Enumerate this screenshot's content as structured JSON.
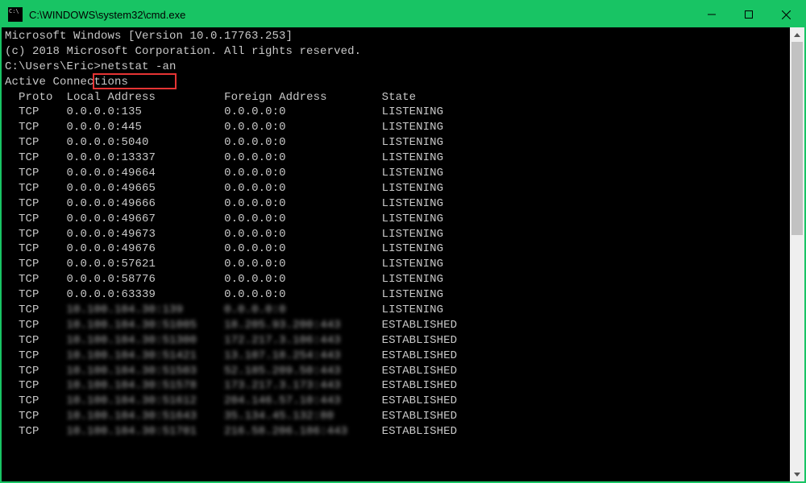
{
  "window": {
    "title": "C:\\WINDOWS\\system32\\cmd.exe"
  },
  "header": {
    "line1": "Microsoft Windows [Version 10.0.17763.253]",
    "line2": "(c) 2018 Microsoft Corporation. All rights reserved."
  },
  "prompt": {
    "path": "C:\\Users\\Eric>",
    "command": "netstat -an"
  },
  "section_title": "Active Connections",
  "columns": {
    "proto": "Proto",
    "local": "Local Address",
    "foreign": "Foreign Address",
    "state": "State"
  },
  "rows": [
    {
      "proto": "TCP",
      "local": "0.0.0.0:135",
      "foreign": "0.0.0.0:0",
      "state": "LISTENING",
      "blur": false
    },
    {
      "proto": "TCP",
      "local": "0.0.0.0:445",
      "foreign": "0.0.0.0:0",
      "state": "LISTENING",
      "blur": false
    },
    {
      "proto": "TCP",
      "local": "0.0.0.0:5040",
      "foreign": "0.0.0.0:0",
      "state": "LISTENING",
      "blur": false
    },
    {
      "proto": "TCP",
      "local": "0.0.0.0:13337",
      "foreign": "0.0.0.0:0",
      "state": "LISTENING",
      "blur": false
    },
    {
      "proto": "TCP",
      "local": "0.0.0.0:49664",
      "foreign": "0.0.0.0:0",
      "state": "LISTENING",
      "blur": false
    },
    {
      "proto": "TCP",
      "local": "0.0.0.0:49665",
      "foreign": "0.0.0.0:0",
      "state": "LISTENING",
      "blur": false
    },
    {
      "proto": "TCP",
      "local": "0.0.0.0:49666",
      "foreign": "0.0.0.0:0",
      "state": "LISTENING",
      "blur": false
    },
    {
      "proto": "TCP",
      "local": "0.0.0.0:49667",
      "foreign": "0.0.0.0:0",
      "state": "LISTENING",
      "blur": false
    },
    {
      "proto": "TCP",
      "local": "0.0.0.0:49673",
      "foreign": "0.0.0.0:0",
      "state": "LISTENING",
      "blur": false
    },
    {
      "proto": "TCP",
      "local": "0.0.0.0:49676",
      "foreign": "0.0.0.0:0",
      "state": "LISTENING",
      "blur": false
    },
    {
      "proto": "TCP",
      "local": "0.0.0.0:57621",
      "foreign": "0.0.0.0:0",
      "state": "LISTENING",
      "blur": false
    },
    {
      "proto": "TCP",
      "local": "0.0.0.0:58776",
      "foreign": "0.0.0.0:0",
      "state": "LISTENING",
      "blur": false
    },
    {
      "proto": "TCP",
      "local": "0.0.0.0:63339",
      "foreign": "0.0.0.0:0",
      "state": "LISTENING",
      "blur": false
    },
    {
      "proto": "TCP",
      "local": "10.100.104.30:139",
      "foreign": "0.0.0.0:0",
      "state": "LISTENING",
      "blur": true
    },
    {
      "proto": "TCP",
      "local": "10.100.104.30:51005",
      "foreign": "18.205.93.200:443",
      "state": "ESTABLISHED",
      "blur": true
    },
    {
      "proto": "TCP",
      "local": "10.100.104.30:51300",
      "foreign": "172.217.3.106:443",
      "state": "ESTABLISHED",
      "blur": true
    },
    {
      "proto": "TCP",
      "local": "10.100.104.30:51421",
      "foreign": "13.107.18.254:443",
      "state": "ESTABLISHED",
      "blur": true
    },
    {
      "proto": "TCP",
      "local": "10.100.104.30:51503",
      "foreign": "52.185.209.50:443",
      "state": "ESTABLISHED",
      "blur": true
    },
    {
      "proto": "TCP",
      "local": "10.100.104.30:51578",
      "foreign": "173.217.3.173:443",
      "state": "ESTABLISHED",
      "blur": true
    },
    {
      "proto": "TCP",
      "local": "10.100.104.30:51612",
      "foreign": "204.146.57.10:443",
      "state": "ESTABLISHED",
      "blur": true
    },
    {
      "proto": "TCP",
      "local": "10.100.104.30:51643",
      "foreign": "35.134.45.132:80",
      "state": "ESTABLISHED",
      "blur": true
    },
    {
      "proto": "TCP",
      "local": "10.100.104.30:51701",
      "foreign": "216.58.206.186:443",
      "state": "ESTABLISHED",
      "blur": true
    }
  ]
}
